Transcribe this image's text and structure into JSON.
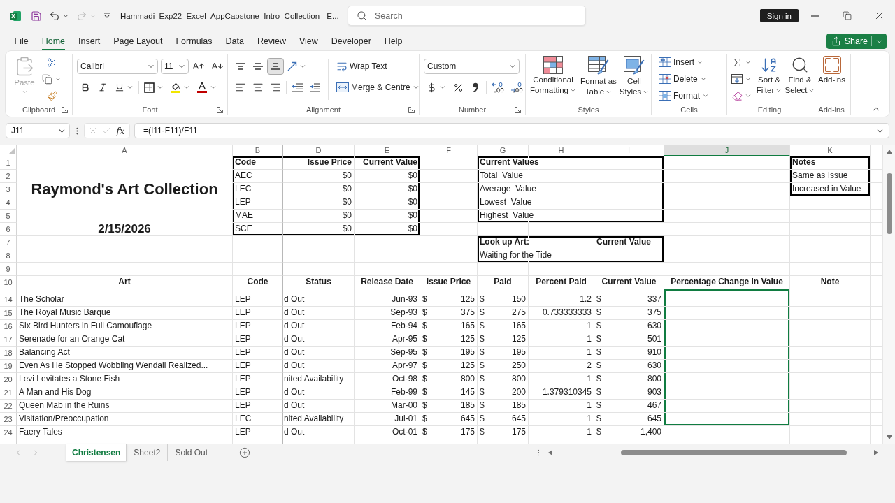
{
  "window": {
    "title": "Hammadi_Exp22_Excel_AppCapstone_Intro_Collection - E...",
    "search": {
      "placeholder": "Search"
    },
    "sign_in": "Sign in"
  },
  "quick_access": [
    {
      "kind": "save",
      "disabled": false
    },
    {
      "kind": "undo",
      "disabled": false
    },
    {
      "kind": "redo",
      "disabled": true
    }
  ],
  "menu_tabs": [
    {
      "label": "File",
      "selected": false
    },
    {
      "label": "Home",
      "selected": true
    },
    {
      "label": "Insert",
      "selected": false
    },
    {
      "label": "Page Layout",
      "selected": false
    },
    {
      "label": "Formulas",
      "selected": false
    },
    {
      "label": "Data",
      "selected": false
    },
    {
      "label": "Review",
      "selected": false
    },
    {
      "label": "View",
      "selected": false
    },
    {
      "label": "Developer",
      "selected": false
    },
    {
      "label": "Help",
      "selected": false
    }
  ],
  "share": "Share",
  "ribbon": {
    "clipboard": {
      "label": "Clipboard",
      "paste": {
        "label": "Paste",
        "disabled": true
      }
    },
    "font": {
      "label": "Font",
      "name": "Calibri",
      "size": "11"
    },
    "alignment": {
      "label": "Alignment",
      "vertical": [
        {
          "kind": "top",
          "selected": false
        },
        {
          "kind": "middle",
          "selected": false
        },
        {
          "kind": "bottom",
          "selected": true
        }
      ],
      "horizontal": [
        {
          "kind": "left",
          "selected": false
        },
        {
          "kind": "center",
          "selected": false
        },
        {
          "kind": "right",
          "selected": false
        }
      ],
      "wrap_text": "Wrap Text",
      "merge": "Merge & Centre"
    },
    "number": {
      "label": "Number",
      "format": "Custom"
    },
    "styles": {
      "label": "Styles",
      "buttons": [
        {
          "kind": "conditional",
          "label": "Conditional Formatting"
        },
        {
          "kind": "table",
          "label": "Format as Table"
        },
        {
          "kind": "cell",
          "label": "Cell Styles"
        }
      ]
    },
    "cells": {
      "label": "Cells",
      "buttons": [
        {
          "kind": "insert",
          "label": "Insert"
        },
        {
          "kind": "delete",
          "label": "Delete"
        },
        {
          "kind": "format",
          "label": "Format"
        }
      ]
    },
    "editing": {
      "label": "Editing",
      "buttons": [
        {
          "kind": "sort",
          "label": "Sort & Filter"
        },
        {
          "kind": "find",
          "label": "Find & Select"
        }
      ]
    },
    "addins": {
      "label": "Add-ins",
      "button": "Add-ins"
    }
  },
  "formula_bar": {
    "name_box": "J11",
    "insert_function": "fx",
    "formula": "=(I11-F11)/F11"
  },
  "sheet": {
    "columns": [
      {
        "label": "A",
        "selected": false
      },
      {
        "label": "B",
        "selected": false
      },
      {
        "label": "D",
        "selected": false
      },
      {
        "label": "E",
        "selected": false
      },
      {
        "label": "F",
        "selected": false
      },
      {
        "label": "G",
        "selected": false
      },
      {
        "label": "H",
        "selected": false
      },
      {
        "label": "I",
        "selected": false
      },
      {
        "label": "J",
        "selected": true
      },
      {
        "label": "K",
        "selected": false
      }
    ],
    "row_numbers": [
      "1",
      "2",
      "3",
      "4",
      "5",
      "6",
      "7",
      "8",
      "9",
      "10"
    ],
    "title_block": {
      "title": "Raymond's Art Collection",
      "date": "2/15/2026"
    },
    "code_summary": {
      "columns": [
        "Code",
        "Issue Price",
        "Current Value"
      ],
      "rows": [
        [
          "AEC",
          "$0",
          "$0"
        ],
        [
          "LEC",
          "$0",
          "$0"
        ],
        [
          "LEP",
          "$0",
          "$0"
        ],
        [
          "MAE",
          "$0",
          "$0"
        ],
        [
          "SCE",
          "$0",
          "$0"
        ]
      ]
    },
    "current_values": {
      "heading": "Current Values",
      "rows": [
        "Total  Value",
        "Average  Value",
        "Lowest  Value",
        "Highest  Value"
      ]
    },
    "lookup": {
      "label": "Look up Art:",
      "value_heading": "Current Value",
      "art": "Waiting for the Tide"
    },
    "notes": {
      "heading": "Notes",
      "rows": [
        "Same as Issue",
        "Increased in Value"
      ]
    },
    "art_table": {
      "columns": [
        "Art",
        "Code",
        "Status",
        "Release Date",
        "Issue Price",
        "Paid",
        "Percent Paid",
        "Current Value",
        "Percentage Change in Value",
        "Note"
      ],
      "rows": [
        {
          "number": "14",
          "art": "The Scholar",
          "code": "LEP",
          "status": "d Out",
          "release_date": "Jun-93",
          "issue_price": {
            "currency": "$",
            "amount": "125"
          },
          "paid": {
            "currency": "$",
            "amount": "150"
          },
          "percent_paid": "1.2",
          "current_value": {
            "currency": "$",
            "amount": "337"
          },
          "selected": true
        },
        {
          "number": "15",
          "art": "The Royal Music Barque",
          "code": "LEP",
          "status": "d Out",
          "release_date": "Sep-93",
          "issue_price": {
            "currency": "$",
            "amount": "375"
          },
          "paid": {
            "currency": "$",
            "amount": "275"
          },
          "percent_paid": "0.733333333",
          "current_value": {
            "currency": "$",
            "amount": "375"
          },
          "selected": true
        },
        {
          "number": "16",
          "art": "Six Bird Hunters in Full Camouflage",
          "code": "LEP",
          "status": "d Out",
          "release_date": "Feb-94",
          "issue_price": {
            "currency": "$",
            "amount": "165"
          },
          "paid": {
            "currency": "$",
            "amount": "165"
          },
          "percent_paid": "1",
          "current_value": {
            "currency": "$",
            "amount": "630"
          },
          "selected": true
        },
        {
          "number": "17",
          "art": "Serenade for an Orange Cat",
          "code": "LEP",
          "status": "d Out",
          "release_date": "Apr-95",
          "issue_price": {
            "currency": "$",
            "amount": "125"
          },
          "paid": {
            "currency": "$",
            "amount": "125"
          },
          "percent_paid": "1",
          "current_value": {
            "currency": "$",
            "amount": "501"
          },
          "selected": true
        },
        {
          "number": "18",
          "art": "Balancing Act",
          "code": "LEP",
          "status": "d Out",
          "release_date": "Sep-95",
          "issue_price": {
            "currency": "$",
            "amount": "195"
          },
          "paid": {
            "currency": "$",
            "amount": "195"
          },
          "percent_paid": "1",
          "current_value": {
            "currency": "$",
            "amount": "910"
          },
          "selected": true
        },
        {
          "number": "19",
          "art": "Even As He Stopped Wobbling Wendall Realized...",
          "code": "LEP",
          "status": "d Out",
          "release_date": "Apr-97",
          "issue_price": {
            "currency": "$",
            "amount": "125"
          },
          "paid": {
            "currency": "$",
            "amount": "250"
          },
          "percent_paid": "2",
          "current_value": {
            "currency": "$",
            "amount": "630"
          },
          "selected": true
        },
        {
          "number": "20",
          "art": "Levi Levitates a Stone Fish",
          "code": "LEP",
          "status": "nited Availability",
          "release_date": "Oct-98",
          "issue_price": {
            "currency": "$",
            "amount": "800"
          },
          "paid": {
            "currency": "$",
            "amount": "800"
          },
          "percent_paid": "1",
          "current_value": {
            "currency": "$",
            "amount": "800"
          },
          "selected": true
        },
        {
          "number": "21",
          "art": "A Man and His Dog",
          "code": "LEP",
          "status": "d Out",
          "release_date": "Feb-99",
          "issue_price": {
            "currency": "$",
            "amount": "145"
          },
          "paid": {
            "currency": "$",
            "amount": "200"
          },
          "percent_paid": "1.379310345",
          "current_value": {
            "currency": "$",
            "amount": "903"
          },
          "selected": true
        },
        {
          "number": "22",
          "art": "Queen Mab in the Ruins",
          "code": "LEP",
          "status": "d Out",
          "release_date": "Mar-00",
          "issue_price": {
            "currency": "$",
            "amount": "185"
          },
          "paid": {
            "currency": "$",
            "amount": "185"
          },
          "percent_paid": "1",
          "current_value": {
            "currency": "$",
            "amount": "467"
          },
          "selected": true
        },
        {
          "number": "23",
          "art": "Visitation/Preoccupation",
          "code": "LEC",
          "status": "nited Availability",
          "release_date": "Jul-01",
          "issue_price": {
            "currency": "$",
            "amount": "645"
          },
          "paid": {
            "currency": "$",
            "amount": "645"
          },
          "percent_paid": "1",
          "current_value": {
            "currency": "$",
            "amount": "645"
          },
          "selected": true
        },
        {
          "number": "24",
          "art": "Faery Tales",
          "code": "LEP",
          "status": "d Out",
          "release_date": "Oct-01",
          "issue_price": {
            "currency": "$",
            "amount": "175"
          },
          "paid": {
            "currency": "$",
            "amount": "175"
          },
          "percent_paid": "1",
          "current_value": {
            "currency": "$",
            "amount": "1,400"
          },
          "selected": false
        }
      ]
    }
  },
  "sheet_tabs": [
    {
      "label": "Christensen",
      "selected": true
    },
    {
      "label": "Sheet2",
      "selected": false
    },
    {
      "label": "Sold Out",
      "selected": false
    }
  ]
}
